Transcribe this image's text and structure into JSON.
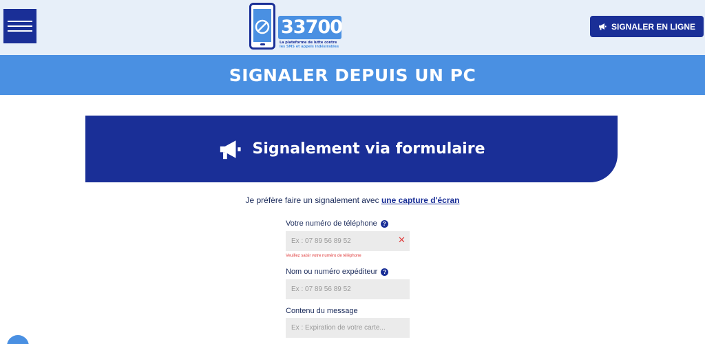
{
  "header": {
    "logo_number": "33700",
    "logo_tagline_line1": "La plateforme de lutte contre",
    "logo_tagline_line2": "les SMS et appels indésirables",
    "cta_label": "SIGNALER EN LIGNE"
  },
  "band": {
    "title": "SIGNALER DEPUIS UN PC"
  },
  "card": {
    "title": "Signalement via formulaire"
  },
  "form": {
    "preference_text": "Je préfère faire un signalement avec ",
    "preference_link": "une capture d'écran",
    "phone_label": "Votre numéro de téléphone",
    "phone_placeholder": "Ex : 07 89 56 89 52",
    "phone_error": "Veuillez saisir votre numéro de téléphone",
    "sender_label": "Nom ou numéro expéditeur",
    "sender_placeholder": "Ex : 07 89 56 89 52",
    "message_label": "Contenu du message",
    "message_placeholder": "Ex : Expiration de votre carte...",
    "help_glyph": "?",
    "clear_glyph": "✕"
  },
  "colors": {
    "navy": "#1a2f97",
    "blue": "#4a90e2",
    "header_bg": "#e7eff9",
    "error": "#e04040"
  },
  "icons": [
    "menu-icon",
    "phone-blocked-icon",
    "megaphone-icon",
    "help-icon",
    "clear-icon"
  ]
}
